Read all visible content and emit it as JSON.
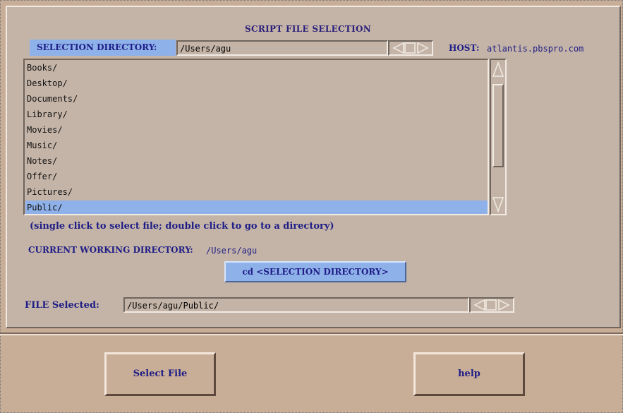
{
  "dialog": {
    "title": "SCRIPT FILE SELECTION",
    "selection_directory_label": "SELECTION DIRECTORY:",
    "selection_directory_value": "/Users/agu",
    "host_label": "HOST:",
    "host_value": "atlantis.pbspro.com",
    "hint": "(single click to select file; double click to go to a directory)",
    "cwd_label": "CURRENT WORKING DIRECTORY:",
    "cwd_value": "/Users/agu",
    "cd_button_label": "cd <SELECTION DIRECTORY>",
    "file_selected_label": "FILE Selected:",
    "file_selected_value": "/Users/agu/Public/"
  },
  "list": {
    "items": [
      {
        "label": "Books/"
      },
      {
        "label": "Desktop/"
      },
      {
        "label": "Documents/"
      },
      {
        "label": "Library/"
      },
      {
        "label": "Movies/"
      },
      {
        "label": "Music/"
      },
      {
        "label": "Notes/"
      },
      {
        "label": "Offer/"
      },
      {
        "label": "Pictures/"
      },
      {
        "label": "Public/"
      }
    ],
    "selected_index": 9
  },
  "footer": {
    "select_file_label": "Select File",
    "help_label": "help"
  },
  "colors": {
    "panel_bg": "#c4b4a7",
    "footer_bg": "#c8ad97",
    "highlight": "#8fb1ea",
    "text_dark_blue": "#1e1d86"
  }
}
